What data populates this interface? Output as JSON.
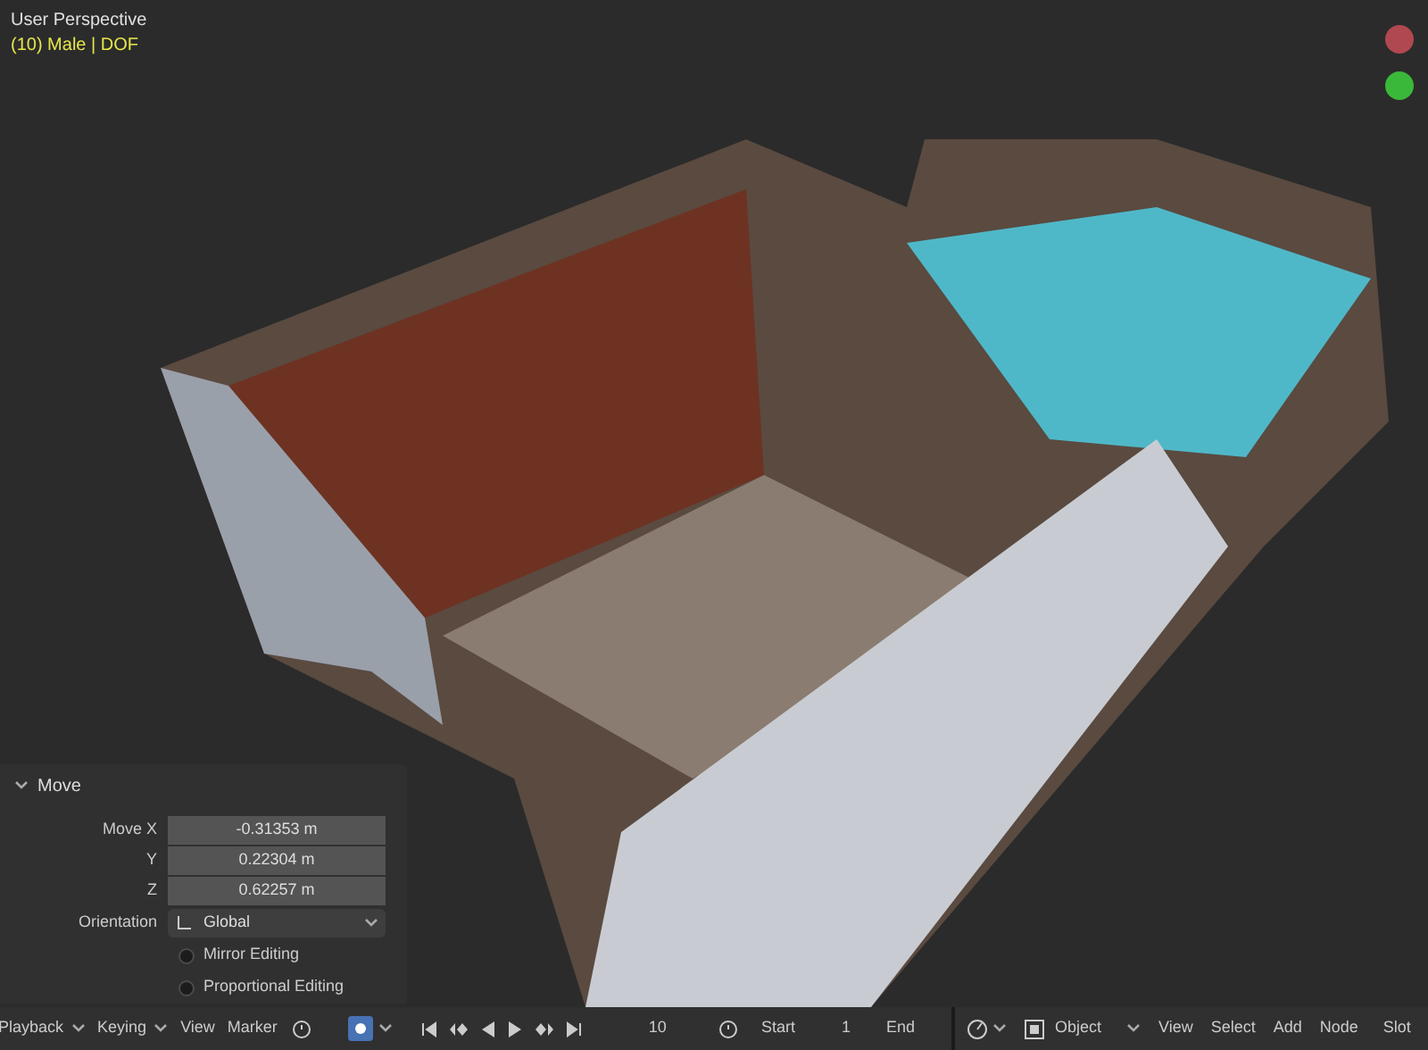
{
  "viewport": {
    "title": "User Perspective",
    "info": "(10) Male | DOF"
  },
  "redo_panel": {
    "title": "Move",
    "expanded": true,
    "fields": [
      {
        "label": "Move X",
        "value": "-0.31353 m"
      },
      {
        "label": "Y",
        "value": "0.22304 m"
      },
      {
        "label": "Z",
        "value": "0.62257 m"
      }
    ],
    "orientation": {
      "label": "Orientation",
      "value": "Global"
    },
    "options": [
      {
        "label": "Mirror Editing",
        "checked": false
      },
      {
        "label": "Proportional Editing",
        "checked": false
      }
    ]
  },
  "timeline": {
    "menus": [
      {
        "label": "Playback",
        "dropdown": true
      },
      {
        "label": "Keying",
        "dropdown": true
      },
      {
        "label": "View",
        "dropdown": false
      },
      {
        "label": "Marker",
        "dropdown": false
      }
    ],
    "auto_keying": true,
    "frame": "10",
    "start_label": "Start",
    "start": "1",
    "end_label": "End"
  },
  "node_header": {
    "mode": "Object",
    "menus": [
      "View",
      "Select",
      "Add",
      "Node",
      "Slot"
    ]
  }
}
